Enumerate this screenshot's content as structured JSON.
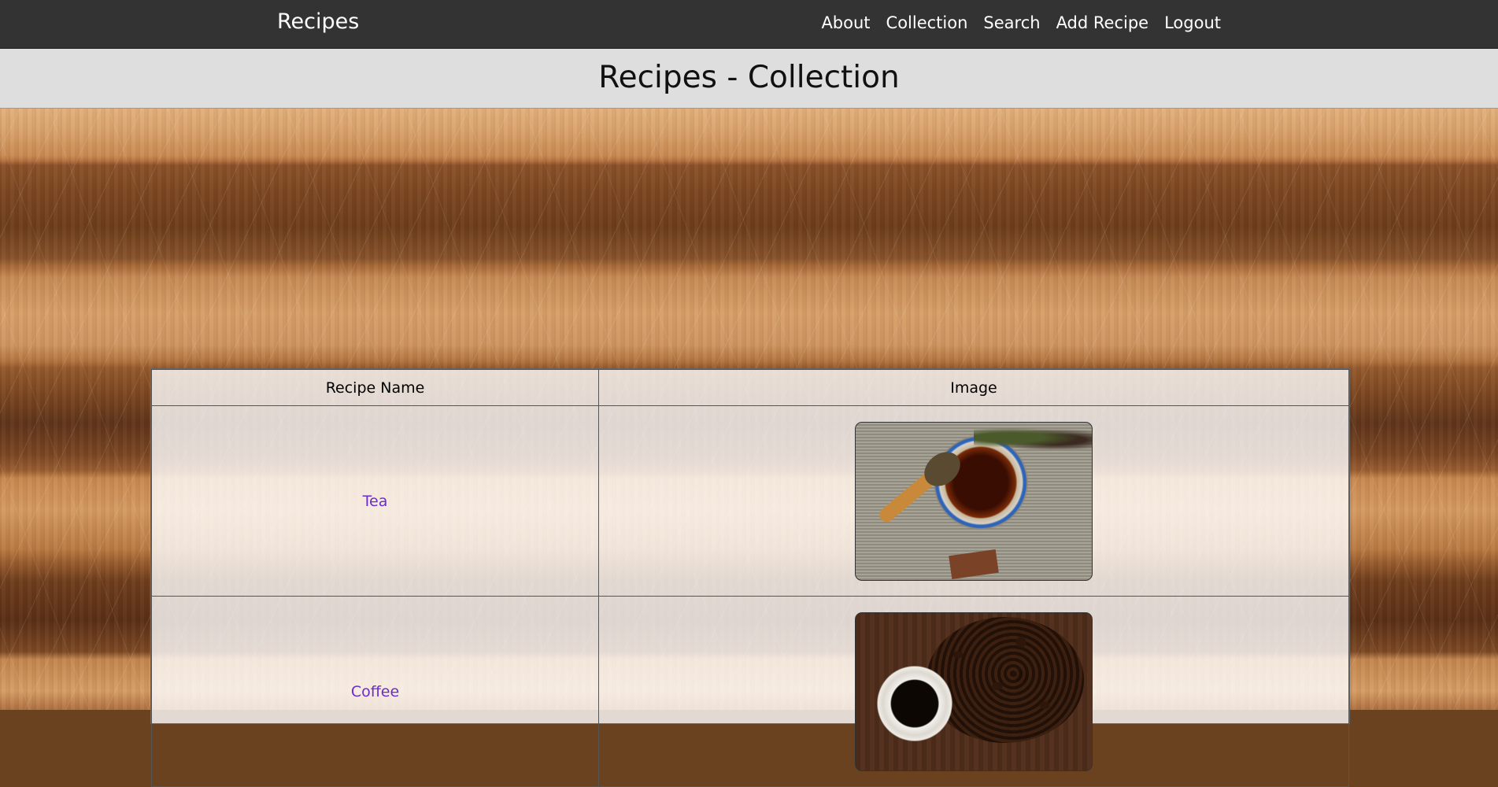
{
  "navbar": {
    "brand": "Recipes",
    "links": [
      "About",
      "Collection",
      "Search",
      "Add Recipe",
      "Logout"
    ]
  },
  "header": {
    "title": "Recipes - Collection"
  },
  "table": {
    "columns": [
      "Recipe Name",
      "Image"
    ],
    "rows": [
      {
        "name": "Tea",
        "image_icon": "tea-photo"
      },
      {
        "name": "Coffee",
        "image_icon": "coffee-photo"
      }
    ]
  },
  "colors": {
    "navbar_bg": "#333333",
    "header_bg": "#dedede",
    "link_color": "#6a2bd0"
  }
}
